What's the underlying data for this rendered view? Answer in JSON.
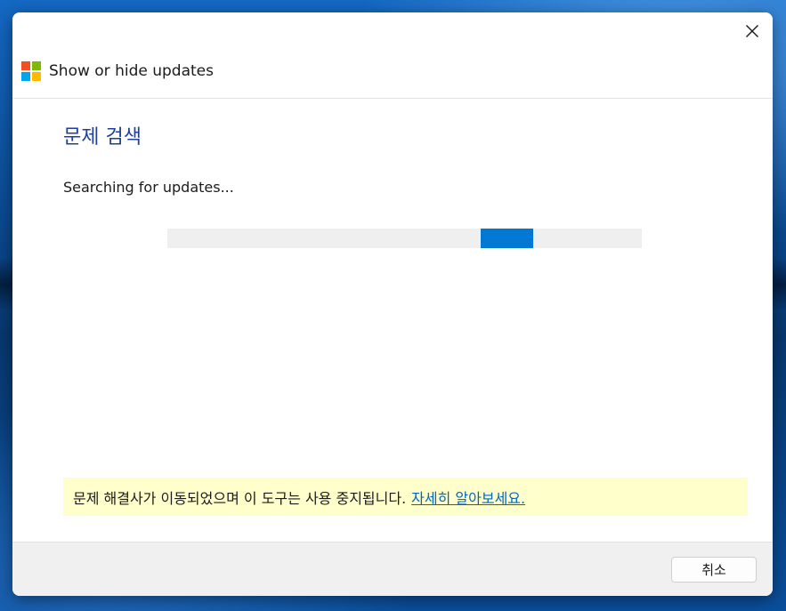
{
  "window": {
    "title": "Show or hide updates",
    "close_icon": "close-icon",
    "logo_icon": "windows-logo-icon"
  },
  "main": {
    "page_title": "문제 검색",
    "status_text": "Searching for updates...",
    "progress": {
      "indeterminate": true,
      "chunk_start_fraction": 0.66,
      "chunk_width_fraction": 0.11
    }
  },
  "notice": {
    "text": "문제 해결사가 이동되었으며 이 도구는 사용 중지됩니다.",
    "link_text": "자세히 알아보세요."
  },
  "footer": {
    "cancel_label": "취소"
  },
  "colors": {
    "accent": "#0078d4",
    "title_blue": "#1e3f9e",
    "link": "#0067c0",
    "notice_bg": "#ffffcc"
  }
}
